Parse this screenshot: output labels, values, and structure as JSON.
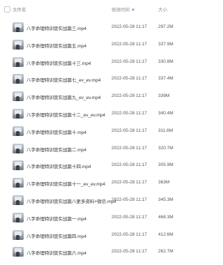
{
  "header": {
    "name_label": "文件名",
    "time_label": "修改时间",
    "size_label": "大小",
    "sort_icon": "sort-down-icon"
  },
  "files": [
    {
      "name": "八字命理特训营实战篇三.mp4",
      "time": "2022-05-28 11:17",
      "size": "297.2M"
    },
    {
      "name": "八字命理特训营实战篇五.mp4",
      "time": "2022-05-28 11:17",
      "size": "337.9M"
    },
    {
      "name": "八字命理特训营实战篇十三.mp4",
      "time": "2022-05-28 11:17",
      "size": "330.8M"
    },
    {
      "name": "八字命理特训营实战篇七_ev_ev.mp4",
      "time": "2022-05-28 11:17",
      "size": "337.4M"
    },
    {
      "name": "八字命理特训营实战篇九_ev_ev.mp4",
      "time": "2022-05-28 11:17",
      "size": "339M"
    },
    {
      "name": "八字命理特训营实战篇十二_ev_ev.mp4",
      "time": "2022-05-28 11:17",
      "size": "340.4M"
    },
    {
      "name": "八字命理特训营实战篇十.mp4",
      "time": "2022-05-28 11:17",
      "size": "311.6M"
    },
    {
      "name": "八字命理特训营实战篇二.mp4",
      "time": "2022-05-28 11:17",
      "size": "320.7M"
    },
    {
      "name": "八字命理特训营实战篇十四.mp4",
      "time": "2022-05-28 11:17",
      "size": "305.9M"
    },
    {
      "name": "八字命理特训营实战篇十一_ev_ev.mp4",
      "time": "2022-05-28 11:17",
      "size": "363M"
    },
    {
      "name": "八字命理特训营实战篇八更多资料+微信.mp4",
      "time": "2022-05-28 11:17",
      "size": "345.3M"
    },
    {
      "name": "八字命理特训营实战篇一.mp4",
      "time": "2022-05-28 11:17",
      "size": "468.3M"
    },
    {
      "name": "八字命理特训营实战篇四.mp4",
      "time": "2022-05-28 11:17",
      "size": "412.6M"
    },
    {
      "name": "八字命理特训营实战篇六.mp4",
      "time": "2022-05-28 11:17",
      "size": "262.7M"
    }
  ]
}
